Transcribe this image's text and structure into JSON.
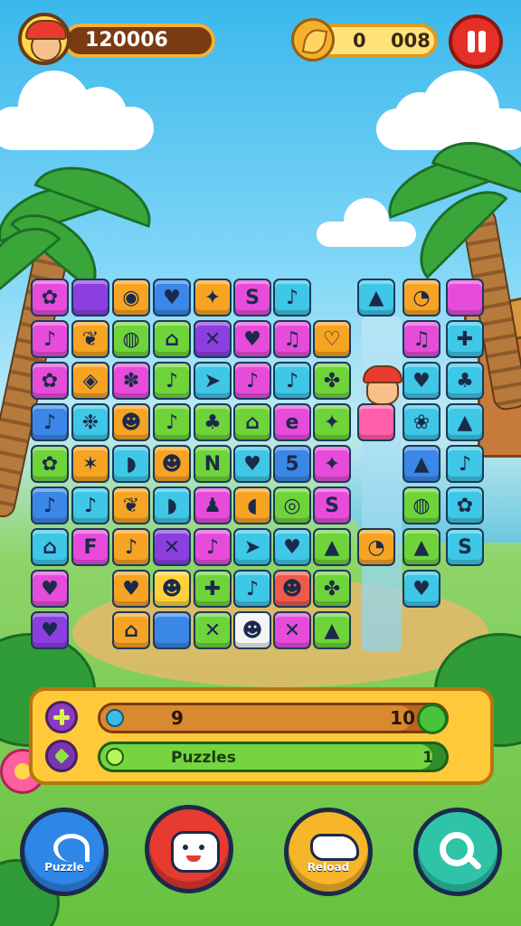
{
  "hud": {
    "score": "120006",
    "coins_left": "0",
    "coins_right": "008"
  },
  "panel": {
    "level_current": "9",
    "level_max": "10",
    "level_fraction": 0.9,
    "puzzles_label": "Puzzles",
    "puzzles_value": "1",
    "puzzles_fraction": 0.96
  },
  "buttons": {
    "b1_label": "Puzzle",
    "b2_label": "",
    "b3_label": "Reload",
    "b4_label": ""
  },
  "colors": {
    "magenta": "#e64cd9",
    "purple": "#8c3fe0",
    "orange": "#f7a323",
    "blue": "#3b87e8",
    "green": "#6fd43a",
    "cyan": "#3ec7e6",
    "pink": "#ff5fa8",
    "yellow": "#ffd23a",
    "red": "#f05a4a",
    "white": "#f4f4f4"
  },
  "tiles": [
    {
      "row": 0,
      "col": 0,
      "color": "magenta",
      "glyph": "✿"
    },
    {
      "row": 0,
      "col": 1,
      "color": "purple",
      "glyph": ""
    },
    {
      "row": 0,
      "col": 2,
      "color": "orange",
      "glyph": "◉"
    },
    {
      "row": 0,
      "col": 3,
      "color": "blue",
      "glyph": "♥"
    },
    {
      "row": 0,
      "col": 4,
      "color": "orange",
      "glyph": "✦"
    },
    {
      "row": 0,
      "col": 5,
      "color": "magenta",
      "glyph": "S"
    },
    {
      "row": 0,
      "col": 6,
      "color": "cyan",
      "glyph": "♪"
    },
    {
      "row": 0,
      "col": 8,
      "color": "cyan",
      "glyph": "▲"
    },
    {
      "row": 0,
      "col": 9,
      "color": "orange",
      "glyph": "◔"
    },
    {
      "row": 0,
      "col": 10,
      "color": "magenta",
      "glyph": ""
    },
    {
      "row": 1,
      "col": 0,
      "color": "magenta",
      "glyph": "♪"
    },
    {
      "row": 1,
      "col": 1,
      "color": "orange",
      "glyph": "❦"
    },
    {
      "row": 1,
      "col": 2,
      "color": "green",
      "glyph": "◍"
    },
    {
      "row": 1,
      "col": 3,
      "color": "green",
      "glyph": "⌂"
    },
    {
      "row": 1,
      "col": 4,
      "color": "purple",
      "glyph": "✕"
    },
    {
      "row": 1,
      "col": 5,
      "color": "magenta",
      "glyph": "♥"
    },
    {
      "row": 1,
      "col": 6,
      "color": "magenta",
      "glyph": "♫"
    },
    {
      "row": 1,
      "col": 7,
      "color": "orange",
      "glyph": "♡"
    },
    {
      "row": 1,
      "col": 9,
      "color": "magenta",
      "glyph": "♫"
    },
    {
      "row": 1,
      "col": 10,
      "color": "cyan",
      "glyph": "✚"
    },
    {
      "row": 2,
      "col": 0,
      "color": "magenta",
      "glyph": "✿"
    },
    {
      "row": 2,
      "col": 1,
      "color": "orange",
      "glyph": "◈"
    },
    {
      "row": 2,
      "col": 2,
      "color": "magenta",
      "glyph": "✽"
    },
    {
      "row": 2,
      "col": 3,
      "color": "green",
      "glyph": "♪"
    },
    {
      "row": 2,
      "col": 4,
      "color": "cyan",
      "glyph": "➤"
    },
    {
      "row": 2,
      "col": 5,
      "color": "magenta",
      "glyph": "♪"
    },
    {
      "row": 2,
      "col": 6,
      "color": "cyan",
      "glyph": "♪"
    },
    {
      "row": 2,
      "col": 7,
      "color": "green",
      "glyph": "✤"
    },
    {
      "row": 2,
      "col": 9,
      "color": "cyan",
      "glyph": "♥"
    },
    {
      "row": 2,
      "col": 10,
      "color": "cyan",
      "glyph": "♣"
    },
    {
      "row": 3,
      "col": 0,
      "color": "blue",
      "glyph": "♪"
    },
    {
      "row": 3,
      "col": 1,
      "color": "cyan",
      "glyph": "❉"
    },
    {
      "row": 3,
      "col": 2,
      "color": "orange",
      "glyph": "☻"
    },
    {
      "row": 3,
      "col": 3,
      "color": "green",
      "glyph": "♪"
    },
    {
      "row": 3,
      "col": 4,
      "color": "green",
      "glyph": "♣"
    },
    {
      "row": 3,
      "col": 5,
      "color": "green",
      "glyph": "⌂"
    },
    {
      "row": 3,
      "col": 6,
      "color": "magenta",
      "glyph": "e"
    },
    {
      "row": 3,
      "col": 7,
      "color": "green",
      "glyph": "✦"
    },
    {
      "row": 3,
      "col": 8,
      "color": "pink",
      "glyph": ""
    },
    {
      "row": 3,
      "col": 9,
      "color": "cyan",
      "glyph": "❀"
    },
    {
      "row": 3,
      "col": 10,
      "color": "cyan",
      "glyph": "▲"
    },
    {
      "row": 4,
      "col": 0,
      "color": "green",
      "glyph": "✿"
    },
    {
      "row": 4,
      "col": 1,
      "color": "orange",
      "glyph": "✶"
    },
    {
      "row": 4,
      "col": 2,
      "color": "cyan",
      "glyph": "◗"
    },
    {
      "row": 4,
      "col": 3,
      "color": "orange",
      "glyph": "☻"
    },
    {
      "row": 4,
      "col": 4,
      "color": "green",
      "glyph": "N"
    },
    {
      "row": 4,
      "col": 5,
      "color": "cyan",
      "glyph": "♥"
    },
    {
      "row": 4,
      "col": 6,
      "color": "blue",
      "glyph": "5"
    },
    {
      "row": 4,
      "col": 7,
      "color": "magenta",
      "glyph": "✦"
    },
    {
      "row": 4,
      "col": 9,
      "color": "blue",
      "glyph": "▲"
    },
    {
      "row": 4,
      "col": 10,
      "color": "cyan",
      "glyph": "♪"
    },
    {
      "row": 5,
      "col": 0,
      "color": "blue",
      "glyph": "♪"
    },
    {
      "row": 5,
      "col": 1,
      "color": "cyan",
      "glyph": "♪"
    },
    {
      "row": 5,
      "col": 2,
      "color": "orange",
      "glyph": "❦"
    },
    {
      "row": 5,
      "col": 3,
      "color": "cyan",
      "glyph": "◗"
    },
    {
      "row": 5,
      "col": 4,
      "color": "magenta",
      "glyph": "♟"
    },
    {
      "row": 5,
      "col": 5,
      "color": "orange",
      "glyph": "◖"
    },
    {
      "row": 5,
      "col": 6,
      "color": "green",
      "glyph": "◎"
    },
    {
      "row": 5,
      "col": 7,
      "color": "magenta",
      "glyph": "S"
    },
    {
      "row": 5,
      "col": 9,
      "color": "green",
      "glyph": "◍"
    },
    {
      "row": 5,
      "col": 10,
      "color": "cyan",
      "glyph": "✿"
    },
    {
      "row": 6,
      "col": 0,
      "color": "cyan",
      "glyph": "⌂"
    },
    {
      "row": 6,
      "col": 1,
      "color": "magenta",
      "glyph": "F"
    },
    {
      "row": 6,
      "col": 2,
      "color": "orange",
      "glyph": "♪"
    },
    {
      "row": 6,
      "col": 3,
      "color": "purple",
      "glyph": "✕"
    },
    {
      "row": 6,
      "col": 4,
      "color": "magenta",
      "glyph": "♪"
    },
    {
      "row": 6,
      "col": 5,
      "color": "cyan",
      "glyph": "➤"
    },
    {
      "row": 6,
      "col": 6,
      "color": "cyan",
      "glyph": "♥"
    },
    {
      "row": 6,
      "col": 7,
      "color": "green",
      "glyph": "▲"
    },
    {
      "row": 6,
      "col": 8,
      "color": "orange",
      "glyph": "◔"
    },
    {
      "row": 6,
      "col": 9,
      "color": "green",
      "glyph": "▲"
    },
    {
      "row": 6,
      "col": 10,
      "color": "cyan",
      "glyph": "S"
    },
    {
      "row": 7,
      "col": 0,
      "color": "magenta",
      "glyph": "♥"
    },
    {
      "row": 7,
      "col": 2,
      "color": "orange",
      "glyph": "♥"
    },
    {
      "row": 7,
      "col": 3,
      "color": "yellow",
      "glyph": "☻"
    },
    {
      "row": 7,
      "col": 4,
      "color": "green",
      "glyph": "✚"
    },
    {
      "row": 7,
      "col": 5,
      "color": "cyan",
      "glyph": "♪"
    },
    {
      "row": 7,
      "col": 6,
      "color": "red",
      "glyph": "☻"
    },
    {
      "row": 7,
      "col": 7,
      "color": "green",
      "glyph": "✤"
    },
    {
      "row": 7,
      "col": 9,
      "color": "cyan",
      "glyph": "♥"
    },
    {
      "row": 8,
      "col": 0,
      "color": "purple",
      "glyph": "♥"
    },
    {
      "row": 8,
      "col": 2,
      "color": "orange",
      "glyph": "⌂"
    },
    {
      "row": 8,
      "col": 3,
      "color": "blue",
      "glyph": ""
    },
    {
      "row": 8,
      "col": 4,
      "color": "green",
      "glyph": "✕"
    },
    {
      "row": 8,
      "col": 5,
      "color": "white",
      "glyph": "☻"
    },
    {
      "row": 8,
      "col": 6,
      "color": "magenta",
      "glyph": "✕"
    },
    {
      "row": 8,
      "col": 7,
      "color": "green",
      "glyph": "▲"
    }
  ]
}
